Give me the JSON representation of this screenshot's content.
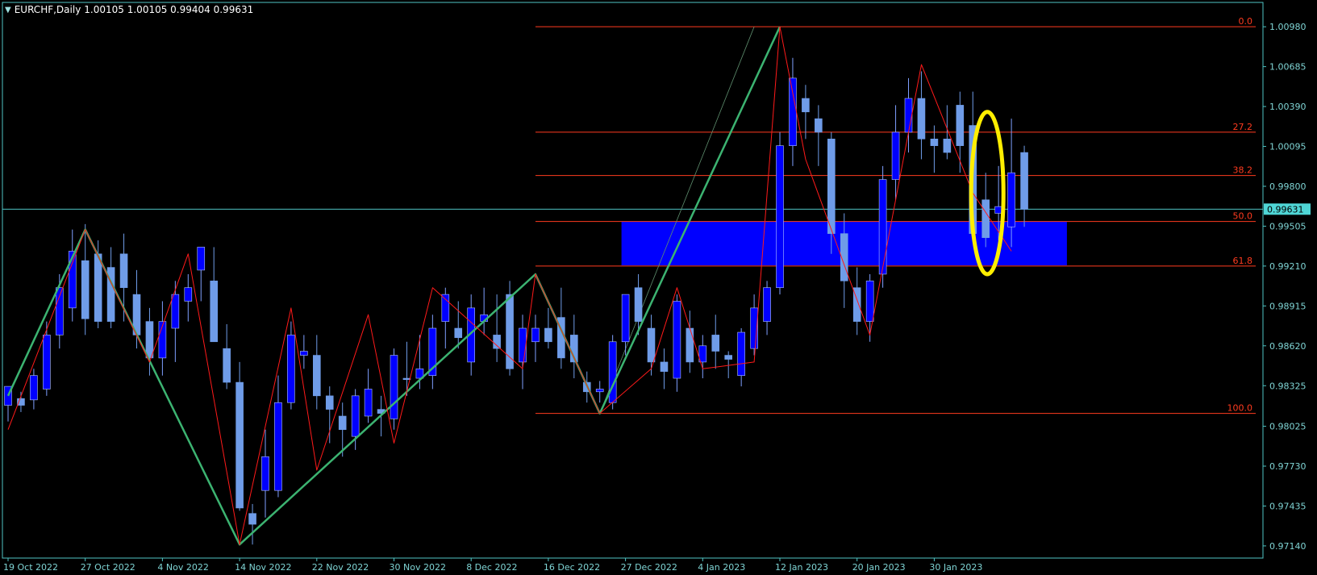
{
  "header": {
    "symbol_tf": "EURCHF,Daily",
    "ohlc": "1.00105 1.00105 0.99404 0.99631"
  },
  "colors": {
    "background": "#000000",
    "frame": "#4fc3c3",
    "axis_text": "#7fd4d4",
    "bull_candle": "#0000ff",
    "bear_candle": "#6f9ce8",
    "zigzag_red": "#ff1a1a",
    "zigzag_green": "#3cb371",
    "fib_line": "#ff3b1f",
    "fib_label": "#ff3b1f",
    "zone_fill": "#0000ff",
    "marker_ellipse": "#ffee00",
    "price_tag_bg": "#4fd6d6"
  },
  "chart_data": {
    "type": "candlestick",
    "symbol": "EURCHF",
    "timeframe": "Daily",
    "y_ticks": [
      "1.00980",
      "1.00685",
      "1.00390",
      "1.00095",
      "0.99800",
      "0.99505",
      "0.99210",
      "0.98915",
      "0.98620",
      "0.98325",
      "0.98025",
      "0.97730",
      "0.97435",
      "0.97140"
    ],
    "ylim": [
      0.9705,
      1.0116
    ],
    "x_ticks": [
      {
        "label": "19 Oct 2022",
        "i": 0
      },
      {
        "label": "27 Oct 2022",
        "i": 6
      },
      {
        "label": "4 Nov 2022",
        "i": 12
      },
      {
        "label": "14 Nov 2022",
        "i": 18
      },
      {
        "label": "22 Nov 2022",
        "i": 24
      },
      {
        "label": "30 Nov 2022",
        "i": 30
      },
      {
        "label": "8 Dec 2022",
        "i": 36
      },
      {
        "label": "16 Dec 2022",
        "i": 42
      },
      {
        "label": "27 Dec 2022",
        "i": 48
      },
      {
        "label": "4 Jan 2023",
        "i": 54
      },
      {
        "label": "12 Jan 2023",
        "i": 60
      },
      {
        "label": "20 Jan 2023",
        "i": 66
      },
      {
        "label": "30 Jan 2023",
        "i": 72
      }
    ],
    "current_price": "0.99631",
    "candles": [
      [
        0.9818,
        0.9832,
        0.9806,
        0.9832
      ],
      [
        0.9823,
        0.9828,
        0.9813,
        0.9818
      ],
      [
        0.9822,
        0.9845,
        0.9815,
        0.984
      ],
      [
        0.983,
        0.988,
        0.9825,
        0.987
      ],
      [
        0.987,
        0.9915,
        0.986,
        0.9905
      ],
      [
        0.989,
        0.9948,
        0.988,
        0.9932
      ],
      [
        0.9925,
        0.9952,
        0.987,
        0.9882
      ],
      [
        0.993,
        0.994,
        0.9875,
        0.988
      ],
      [
        0.992,
        0.9935,
        0.9875,
        0.988
      ],
      [
        0.993,
        0.9945,
        0.988,
        0.9905
      ],
      [
        0.99,
        0.9918,
        0.986,
        0.987
      ],
      [
        0.988,
        0.989,
        0.984,
        0.9853
      ],
      [
        0.9853,
        0.9895,
        0.984,
        0.988
      ],
      [
        0.9875,
        0.991,
        0.985,
        0.99
      ],
      [
        0.9895,
        0.9915,
        0.988,
        0.9905
      ],
      [
        0.9918,
        0.9935,
        0.9895,
        0.9935
      ],
      [
        0.991,
        0.9935,
        0.9865,
        0.9865
      ],
      [
        0.986,
        0.9878,
        0.983,
        0.9835
      ],
      [
        0.9835,
        0.985,
        0.974,
        0.9742
      ],
      [
        0.9738,
        0.9745,
        0.9715,
        0.973
      ],
      [
        0.9755,
        0.98,
        0.9735,
        0.978
      ],
      [
        0.9755,
        0.984,
        0.975,
        0.982
      ],
      [
        0.982,
        0.988,
        0.9815,
        0.987
      ],
      [
        0.9855,
        0.987,
        0.9845,
        0.9858
      ],
      [
        0.9855,
        0.987,
        0.9815,
        0.9825
      ],
      [
        0.9825,
        0.9832,
        0.979,
        0.9815
      ],
      [
        0.981,
        0.982,
        0.978,
        0.98
      ],
      [
        0.9795,
        0.983,
        0.9785,
        0.9825
      ],
      [
        0.981,
        0.9845,
        0.9805,
        0.983
      ],
      [
        0.9815,
        0.9825,
        0.9795,
        0.9812
      ],
      [
        0.9808,
        0.986,
        0.98,
        0.9855
      ],
      [
        0.9838,
        0.9865,
        0.9825,
        0.9837
      ],
      [
        0.9838,
        0.987,
        0.983,
        0.9845
      ],
      [
        0.984,
        0.9885,
        0.983,
        0.9875
      ],
      [
        0.988,
        0.9905,
        0.986,
        0.99
      ],
      [
        0.9875,
        0.9895,
        0.986,
        0.9868
      ],
      [
        0.985,
        0.99,
        0.984,
        0.989
      ],
      [
        0.988,
        0.9905,
        0.987,
        0.9885
      ],
      [
        0.987,
        0.99,
        0.985,
        0.986
      ],
      [
        0.99,
        0.991,
        0.984,
        0.9845
      ],
      [
        0.985,
        0.9885,
        0.983,
        0.9875
      ],
      [
        0.9865,
        0.9885,
        0.985,
        0.9875
      ],
      [
        0.9875,
        0.989,
        0.986,
        0.9865
      ],
      [
        0.9883,
        0.9905,
        0.9845,
        0.9853
      ],
      [
        0.987,
        0.9885,
        0.9838,
        0.985
      ],
      [
        0.9835,
        0.9843,
        0.982,
        0.9828
      ],
      [
        0.9828,
        0.9836,
        0.982,
        0.983
      ],
      [
        0.982,
        0.987,
        0.9815,
        0.9865
      ],
      [
        0.9865,
        0.99,
        0.9855,
        0.99
      ],
      [
        0.9905,
        0.9915,
        0.987,
        0.988
      ],
      [
        0.9875,
        0.9885,
        0.984,
        0.985
      ],
      [
        0.985,
        0.986,
        0.983,
        0.9843
      ],
      [
        0.9838,
        0.99,
        0.9828,
        0.9895
      ],
      [
        0.9875,
        0.9888,
        0.9842,
        0.985
      ],
      [
        0.985,
        0.987,
        0.9838,
        0.9862
      ],
      [
        0.987,
        0.9885,
        0.9845,
        0.9858
      ],
      [
        0.9855,
        0.9858,
        0.9838,
        0.9852
      ],
      [
        0.984,
        0.9875,
        0.9832,
        0.9872
      ],
      [
        0.986,
        0.99,
        0.9855,
        0.989
      ],
      [
        0.988,
        0.991,
        0.987,
        0.9905
      ],
      [
        0.9905,
        1.002,
        0.99,
        1.001
      ],
      [
        1.001,
        1.0075,
        0.9995,
        1.006
      ],
      [
        1.0045,
        1.0055,
        1.0015,
        1.0035
      ],
      [
        1.003,
        1.004,
        0.9995,
        1.002
      ],
      [
        1.0015,
        1.002,
        0.993,
        0.9945
      ],
      [
        0.9945,
        0.996,
        0.989,
        0.991
      ],
      [
        0.9905,
        0.992,
        0.987,
        0.988
      ],
      [
        0.988,
        0.9915,
        0.9865,
        0.991
      ],
      [
        0.9915,
        0.9995,
        0.9905,
        0.9985
      ],
      [
        0.9985,
        1.004,
        0.997,
        1.002
      ],
      [
        1.002,
        1.006,
        1.0005,
        1.0045
      ],
      [
        1.0045,
        1.0065,
        1.0,
        1.0015
      ],
      [
        1.0015,
        1.0025,
        0.999,
        1.001
      ],
      [
        1.0015,
        1.004,
        1.0,
        1.0005
      ],
      [
        1.004,
        1.005,
        0.999,
        1.001
      ],
      [
        1.0025,
        1.005,
        0.997,
        0.9945
      ],
      [
        0.997,
        0.999,
        0.9935,
        0.9942
      ],
      [
        0.996,
        0.9995,
        0.994,
        0.9965
      ],
      [
        0.995,
        1.003,
        0.9935,
        0.999
      ],
      [
        1.0005,
        1.001,
        0.995,
        0.9963
      ]
    ],
    "fib_levels": [
      {
        "label": "0.0",
        "price": 1.0098
      },
      {
        "label": "27.2",
        "price": 1.002
      },
      {
        "label": "38.2",
        "price": 0.9988
      },
      {
        "label": "50.0",
        "price": 0.9954
      },
      {
        "label": "61.8",
        "price": 0.9921
      },
      {
        "label": "100.0",
        "price": 0.9812
      }
    ],
    "zone": {
      "from_i": 48,
      "to_i": 82,
      "top": 0.9954,
      "bottom": 0.99215
    },
    "zigzag_green": [
      [
        0,
        0.9825
      ],
      [
        6,
        0.9948
      ],
      [
        18,
        0.9715
      ],
      [
        41,
        0.9915
      ],
      [
        46,
        0.9812
      ],
      [
        60,
        1.0098
      ]
    ],
    "zigzag_red": [
      [
        0,
        0.98
      ],
      [
        6,
        0.9948
      ],
      [
        11,
        0.985
      ],
      [
        14,
        0.993
      ],
      [
        18,
        0.9715
      ],
      [
        22,
        0.989
      ],
      [
        24,
        0.977
      ],
      [
        28,
        0.9885
      ],
      [
        30,
        0.979
      ],
      [
        33,
        0.9905
      ],
      [
        40,
        0.9845
      ],
      [
        41,
        0.9915
      ],
      [
        46,
        0.9812
      ],
      [
        50,
        0.9845
      ],
      [
        52,
        0.9905
      ],
      [
        54,
        0.9845
      ],
      [
        58,
        0.985
      ],
      [
        60,
        1.0098
      ],
      [
        62,
        1.0
      ],
      [
        67,
        0.987
      ],
      [
        71,
        1.007
      ],
      [
        75,
        0.9975
      ],
      [
        78,
        0.9932
      ]
    ],
    "trend_line": [
      [
        46,
        0.9812
      ],
      [
        58,
        1.0098
      ]
    ],
    "marker": {
      "i": 76,
      "top": 1.0035,
      "bottom": 0.9915
    }
  }
}
